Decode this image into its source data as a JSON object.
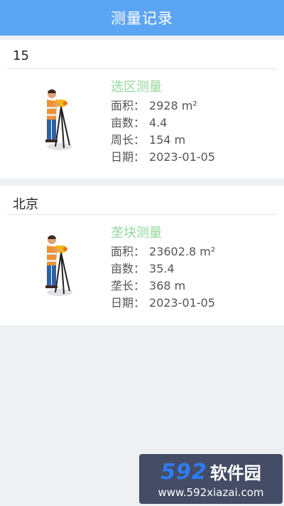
{
  "header": {
    "title": "测量记录"
  },
  "records": [
    {
      "name": "15",
      "type": "选区测量",
      "area_label": "面积：",
      "area_value": "2928 m²",
      "mu_label": "亩数：",
      "mu_value": "4.4",
      "perimeter_label": "周长：",
      "perimeter_value": "154 m",
      "date_label": "日期：",
      "date_value": "2023-01-05"
    },
    {
      "name": "北京",
      "type": "垄块测量",
      "area_label": "面积：",
      "area_value": "23602.8 m²",
      "mu_label": "亩数：",
      "mu_value": "35.4",
      "perimeter_label": "垄长：",
      "perimeter_value": "368 m",
      "date_label": "日期：",
      "date_value": "2023-01-05"
    }
  ],
  "watermark": {
    "brand_num": "592",
    "brand_text": "软件园",
    "url": "www.592xiazai.com"
  },
  "colors": {
    "header": "#5ca5f4",
    "type_green": "#93d89b"
  },
  "icons": [
    "surveyor-illustration"
  ]
}
